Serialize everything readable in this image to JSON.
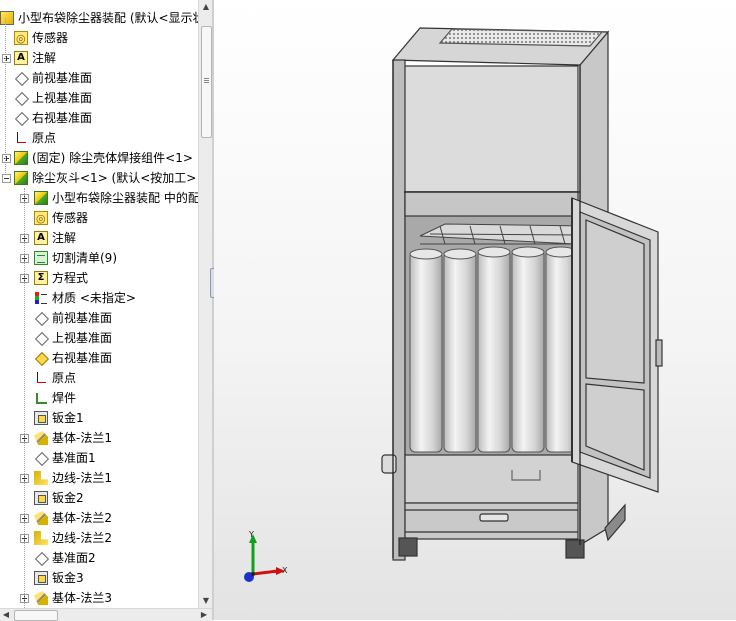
{
  "tree": {
    "items": [
      {
        "label": "小型布袋除尘器装配 (默认<显示状",
        "icon": "assembly-icon",
        "indent": 0,
        "expander": "minus"
      },
      {
        "label": "传感器",
        "icon": "sensor-icon",
        "indent": 1,
        "expander": null
      },
      {
        "label": "注解",
        "icon": "annotation-icon",
        "indent": 1,
        "expander": "plus"
      },
      {
        "label": "前视基准面",
        "icon": "plane-icon",
        "indent": 1,
        "expander": null
      },
      {
        "label": "上视基准面",
        "icon": "plane-icon",
        "indent": 1,
        "expander": null
      },
      {
        "label": "右视基准面",
        "icon": "plane-icon",
        "indent": 1,
        "expander": null
      },
      {
        "label": "原点",
        "icon": "origin-icon",
        "indent": 1,
        "expander": null
      },
      {
        "label": "(固定) 除尘壳体焊接组件<1>",
        "icon": "part-icon",
        "indent": 1,
        "expander": "plus"
      },
      {
        "label": "除尘灰斗<1> (默认<按加工>",
        "icon": "part-icon",
        "indent": 1,
        "expander": "minus"
      },
      {
        "label": "小型布袋除尘器装配 中的配",
        "icon": "mate-group-icon",
        "indent": 2,
        "expander": "plus"
      },
      {
        "label": "传感器",
        "icon": "sensor-icon",
        "indent": 2,
        "expander": null
      },
      {
        "label": "注解",
        "icon": "annotation-icon",
        "indent": 2,
        "expander": "plus"
      },
      {
        "label": "切割清单(9)",
        "icon": "cut-list-icon",
        "indent": 2,
        "expander": "plus"
      },
      {
        "label": "方程式",
        "icon": "equation-icon",
        "indent": 2,
        "expander": "plus"
      },
      {
        "label": "材质 <未指定>",
        "icon": "material-icon",
        "indent": 2,
        "expander": null
      },
      {
        "label": "前视基准面",
        "icon": "plane-icon",
        "indent": 2,
        "expander": null
      },
      {
        "label": "上视基准面",
        "icon": "plane-icon",
        "indent": 2,
        "expander": null
      },
      {
        "label": "右视基准面",
        "icon": "plane-selected-icon",
        "indent": 2,
        "expander": null
      },
      {
        "label": "原点",
        "icon": "origin-icon",
        "indent": 2,
        "expander": null
      },
      {
        "label": "焊件",
        "icon": "weldment-icon",
        "indent": 2,
        "expander": null
      },
      {
        "label": "钣金1",
        "icon": "sheet-metal-icon",
        "indent": 2,
        "expander": null
      },
      {
        "label": "基体-法兰1",
        "icon": "base-flange-icon",
        "indent": 2,
        "expander": "plus"
      },
      {
        "label": "基准面1",
        "icon": "plane-icon",
        "indent": 2,
        "expander": null
      },
      {
        "label": "边线-法兰1",
        "icon": "edge-flange-icon",
        "indent": 2,
        "expander": "plus"
      },
      {
        "label": "钣金2",
        "icon": "sheet-metal-icon",
        "indent": 2,
        "expander": null
      },
      {
        "label": "基体-法兰2",
        "icon": "base-flange-icon",
        "indent": 2,
        "expander": "plus"
      },
      {
        "label": "边线-法兰2",
        "icon": "edge-flange-icon",
        "indent": 2,
        "expander": "plus"
      },
      {
        "label": "基准面2",
        "icon": "plane-icon",
        "indent": 2,
        "expander": null
      },
      {
        "label": "钣金3",
        "icon": "sheet-metal-icon",
        "indent": 2,
        "expander": null
      },
      {
        "label": "基体-法兰3",
        "icon": "base-flange-icon",
        "indent": 2,
        "expander": "plus"
      }
    ]
  },
  "triad": {
    "x_label": "X",
    "y_label": "Y"
  },
  "colors": {
    "triad_x": "#d01010",
    "triad_y": "#10a020",
    "triad_z": "#2030d0",
    "viewport_bg": "#f2f2f2"
  }
}
